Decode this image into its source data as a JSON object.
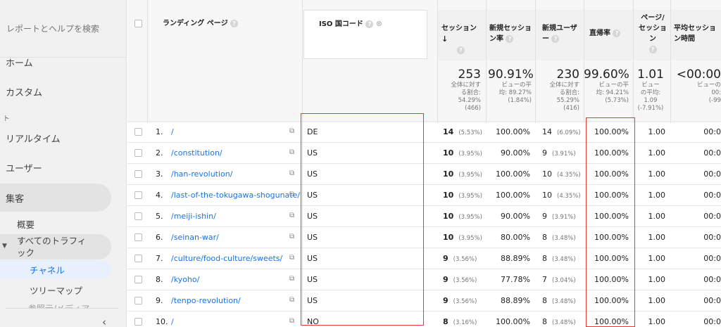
{
  "sidebar": {
    "search_label": "レポートとヘルプを検索",
    "home": "ホーム",
    "custom": "カスタム",
    "small_label": "ト",
    "realtime": "リアルタイム",
    "users": "ユーザー",
    "acquisition": "集客",
    "overview": "概要",
    "all_traffic": "すべてのトラフィック",
    "channels": "チャネル",
    "treemap": "ツリーマップ",
    "cut_item": "参照元/メディア"
  },
  "table": {
    "headers": {
      "landing_page": "ランディング ページ",
      "iso_code": "ISO 国コード",
      "sessions": "セッション",
      "new_session_rate": "新規セッション率",
      "new_users": "新規ユーザー",
      "bounce_rate": "直帰率",
      "pages_per_session": "ページ/セッション",
      "avg_session_duration": "平均セッション時間"
    },
    "summary": {
      "sessions": "253",
      "sessions_note": [
        "全体に対す",
        "る割合:",
        "54.29%",
        "(466)"
      ],
      "new_session_rate": "90.91%",
      "new_session_rate_note": [
        "ビューの平",
        "均: 89.27%",
        "(1.84%)"
      ],
      "new_users": "230",
      "new_users_note": [
        "全体に対す",
        "る割合:",
        "55.29%",
        "(416)"
      ],
      "bounce_rate": "99.60%",
      "bounce_rate_note": [
        "ビューの平",
        "均: 94.21%",
        "(5.73%)"
      ],
      "pages_per_session": "1.01",
      "pages_per_session_note": [
        "ビュー",
        "の平均:",
        "1.09",
        "(-7.91%)"
      ],
      "avg_duration": "<00:00",
      "avg_duration_note": [
        "ビューの",
        "00:",
        "(-99"
      ]
    },
    "rows": [
      {
        "idx": "1.",
        "page": "/",
        "iso": "DE",
        "sessions": "14",
        "sessions_pct": "(5.53%)",
        "new_rate": "100.00%",
        "new_users": "14",
        "new_users_pct": "(6.09%)",
        "bounce": "100.00%",
        "pps": "1.00",
        "dur": "00:0"
      },
      {
        "idx": "2.",
        "page": "/constitution/",
        "iso": "US",
        "sessions": "10",
        "sessions_pct": "(3.95%)",
        "new_rate": "90.00%",
        "new_users": "9",
        "new_users_pct": "(3.91%)",
        "bounce": "100.00%",
        "pps": "1.00",
        "dur": "00:0"
      },
      {
        "idx": "3.",
        "page": "/han-revolution/",
        "iso": "US",
        "sessions": "10",
        "sessions_pct": "(3.95%)",
        "new_rate": "100.00%",
        "new_users": "10",
        "new_users_pct": "(4.35%)",
        "bounce": "100.00%",
        "pps": "1.00",
        "dur": "00:0"
      },
      {
        "idx": "4.",
        "page": "/last-of-the-tokugawa-shogunate/",
        "iso": "US",
        "sessions": "10",
        "sessions_pct": "(3.95%)",
        "new_rate": "100.00%",
        "new_users": "10",
        "new_users_pct": "(4.35%)",
        "bounce": "100.00%",
        "pps": "1.00",
        "dur": "00:0"
      },
      {
        "idx": "5.",
        "page": "/meiji-ishin/",
        "iso": "US",
        "sessions": "10",
        "sessions_pct": "(3.95%)",
        "new_rate": "90.00%",
        "new_users": "9",
        "new_users_pct": "(3.91%)",
        "bounce": "100.00%",
        "pps": "1.00",
        "dur": "00:0"
      },
      {
        "idx": "6.",
        "page": "/seinan-war/",
        "iso": "US",
        "sessions": "10",
        "sessions_pct": "(3.95%)",
        "new_rate": "80.00%",
        "new_users": "8",
        "new_users_pct": "(3.48%)",
        "bounce": "100.00%",
        "pps": "1.00",
        "dur": "00:0"
      },
      {
        "idx": "7.",
        "page": "/culture/food-culture/sweets/",
        "iso": "US",
        "sessions": "9",
        "sessions_pct": "(3.56%)",
        "new_rate": "88.89%",
        "new_users": "8",
        "new_users_pct": "(3.48%)",
        "bounce": "100.00%",
        "pps": "1.00",
        "dur": "00:0"
      },
      {
        "idx": "8.",
        "page": "/kyoho/",
        "iso": "US",
        "sessions": "9",
        "sessions_pct": "(3.56%)",
        "new_rate": "77.78%",
        "new_users": "7",
        "new_users_pct": "(3.04%)",
        "bounce": "100.00%",
        "pps": "1.00",
        "dur": "00:0"
      },
      {
        "idx": "9.",
        "page": "/tenpo-revolution/",
        "iso": "US",
        "sessions": "9",
        "sessions_pct": "(3.56%)",
        "new_rate": "88.89%",
        "new_users": "8",
        "new_users_pct": "(3.48%)",
        "bounce": "100.00%",
        "pps": "1.00",
        "dur": "00:0"
      },
      {
        "idx": "10.",
        "page": "/",
        "iso": "NO",
        "sessions": "8",
        "sessions_pct": "(3.16%)",
        "new_rate": "100.00%",
        "new_users": "8",
        "new_users_pct": "(3.48%)",
        "bounce": "100.00%",
        "pps": "1.00",
        "dur": "00:0"
      }
    ]
  },
  "colors": {
    "highlight_border": "#e53935",
    "link": "#1a73e8"
  }
}
